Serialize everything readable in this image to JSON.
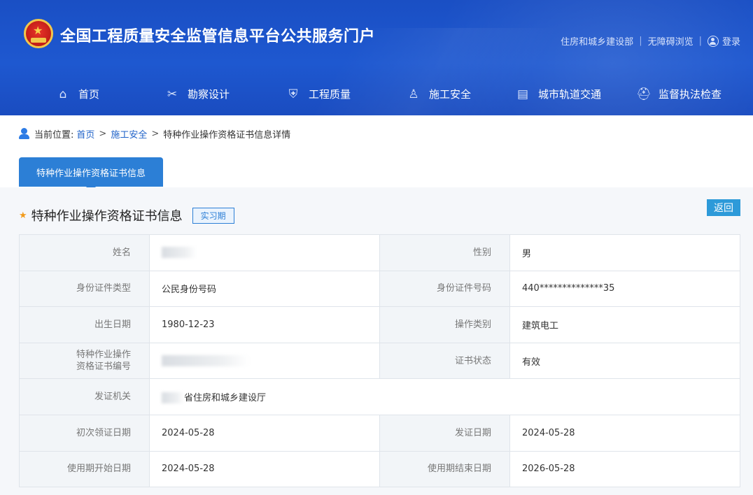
{
  "header": {
    "site_title": "全国工程质量安全监管信息平台公共服务门户",
    "links": [
      "住房和城乡建设部",
      "无障碍浏览"
    ],
    "login_label": "登录",
    "nav": [
      {
        "label": "首页",
        "icon": "home-icon"
      },
      {
        "label": "勘察设计",
        "icon": "tools-icon"
      },
      {
        "label": "工程质量",
        "icon": "shield-icon"
      },
      {
        "label": "施工安全",
        "icon": "worker-icon"
      },
      {
        "label": "城市轨道交通",
        "icon": "train-icon"
      },
      {
        "label": "监督执法检查",
        "icon": "police-cap-icon"
      }
    ]
  },
  "breadcrumb": {
    "prefix": "当前位置:",
    "items": [
      "首页",
      "施工安全"
    ],
    "current": "特种作业操作资格证书信息详情"
  },
  "tab": {
    "label": "特种作业操作资格证书信息"
  },
  "section": {
    "title": "特种作业操作资格证书信息",
    "badge": "实习期",
    "back_label": "返回"
  },
  "fields": {
    "name_label": "姓名",
    "name_value": "",
    "gender_label": "性别",
    "gender_value": "男",
    "id_type_label": "身份证件类型",
    "id_type_value": "公民身份号码",
    "id_no_label": "身份证件号码",
    "id_no_value": "440**************35",
    "birth_label": "出生日期",
    "birth_value": "1980-12-23",
    "op_type_label": "操作类别",
    "op_type_value": "建筑电工",
    "cert_no_label_1": "特种作业操作",
    "cert_no_label_2": "资格证书编号",
    "cert_no_value": "",
    "status_label": "证书状态",
    "status_value": "有效",
    "issuer_label": "发证机关",
    "issuer_value": "省住房和城乡建设厅",
    "first_date_label": "初次领证日期",
    "first_date_value": "2024-05-28",
    "issue_date_label": "发证日期",
    "issue_date_value": "2024-05-28",
    "start_label": "使用期开始日期",
    "start_value": "2024-05-28",
    "end_label": "使用期结束日期",
    "end_value": "2026-05-28"
  }
}
